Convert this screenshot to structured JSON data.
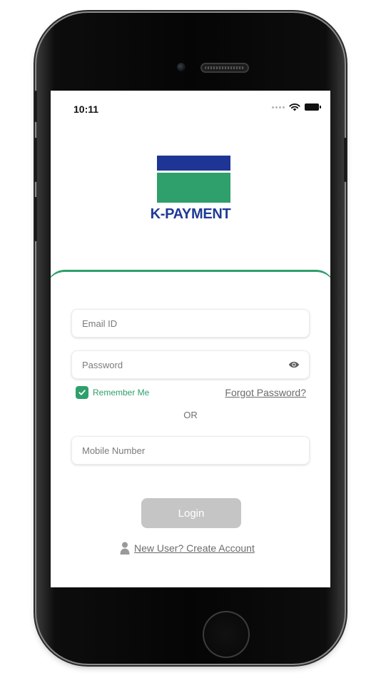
{
  "status_bar": {
    "time": "10:11",
    "icons": [
      "signal-dots-icon",
      "wifi-icon",
      "battery-icon"
    ]
  },
  "brand": {
    "name": "K-PAYMENT",
    "colors": {
      "blue": "#1e3595",
      "green": "#2f9f6b"
    }
  },
  "form": {
    "email": {
      "placeholder": "Email ID",
      "value": ""
    },
    "password": {
      "placeholder": "Password",
      "value": "",
      "toggle_icon": "eye-icon"
    },
    "remember_me": {
      "label": "Remember Me",
      "checked": true
    },
    "forgot_password": "Forgot Password?",
    "or_label": "OR",
    "mobile": {
      "placeholder": "Mobile Number",
      "value": ""
    },
    "login_label": "Login",
    "login_enabled": false,
    "create_account": {
      "label": "New User? Create Account",
      "icon": "user-icon"
    }
  },
  "theme": {
    "accent": "#2f9f6b",
    "disabled_button": "#c5c5c5"
  }
}
